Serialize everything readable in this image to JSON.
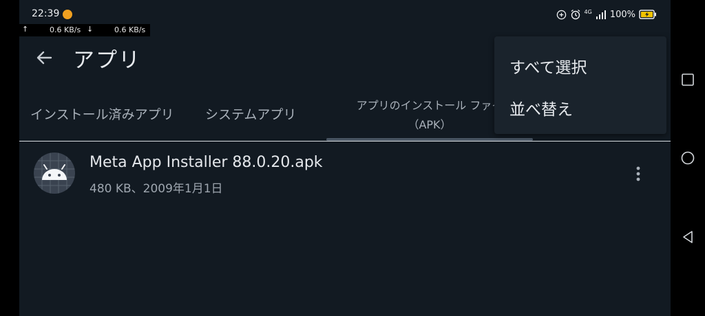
{
  "status_bar": {
    "time": "22:39",
    "upload_speed": "0.6 KB/s",
    "download_speed": "0.6 KB/s",
    "network": "4G",
    "battery": "100%"
  },
  "app_bar": {
    "title": "アプリ"
  },
  "tabs": [
    {
      "label": "インストール済みアプリ"
    },
    {
      "label": "システムアプリ"
    },
    {
      "label": "アプリのインストール ファイ",
      "sublabel": "（APK）"
    }
  ],
  "apk_list": [
    {
      "name": "Meta App Installer 88.0.20.apk",
      "meta": "480 KB、2009年1月1日"
    }
  ],
  "overflow_menu": {
    "items": [
      {
        "label": "すべて選択"
      },
      {
        "label": "並べ替え"
      }
    ]
  },
  "colors": {
    "background": "#121a22",
    "menu_background": "#1a232c",
    "tab_indicator": "#4a5664",
    "battery_charging": "#f2c200"
  }
}
